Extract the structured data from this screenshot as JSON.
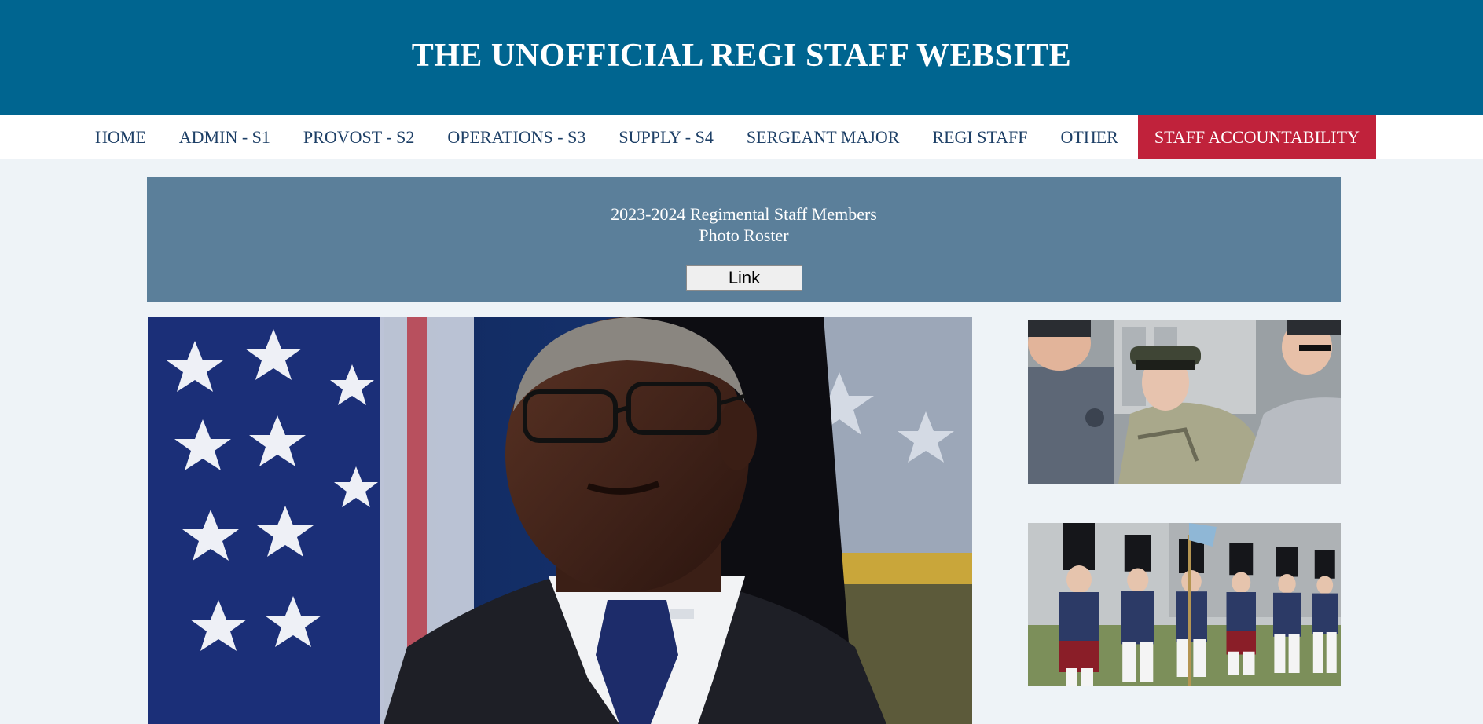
{
  "header": {
    "title": "THE UNOFFICIAL REGI STAFF WEBSITE",
    "background": "#006590"
  },
  "nav": {
    "items": [
      {
        "label": "HOME"
      },
      {
        "label": "ADMIN - S1"
      },
      {
        "label": "PROVOST - S2"
      },
      {
        "label": "OPERATIONS - S3"
      },
      {
        "label": "SUPPLY - S4"
      },
      {
        "label": "SERGEANT MAJOR"
      },
      {
        "label": "REGI STAFF"
      },
      {
        "label": "OTHER"
      },
      {
        "label": "STAFF ACCOUNTABILITY",
        "highlighted": true
      }
    ],
    "accent_color": "#c0223b",
    "text_color": "#1d3f66"
  },
  "banner": {
    "line1": "2023-2024 Regimental Staff Members",
    "line2": "Photo Roster",
    "button_label": "Link",
    "background": "#5b7f9a"
  },
  "images": {
    "main": "official-portrait-photo",
    "side_top": "uniform-inspection-photo",
    "side_bottom": "cadets-marching-photo"
  }
}
